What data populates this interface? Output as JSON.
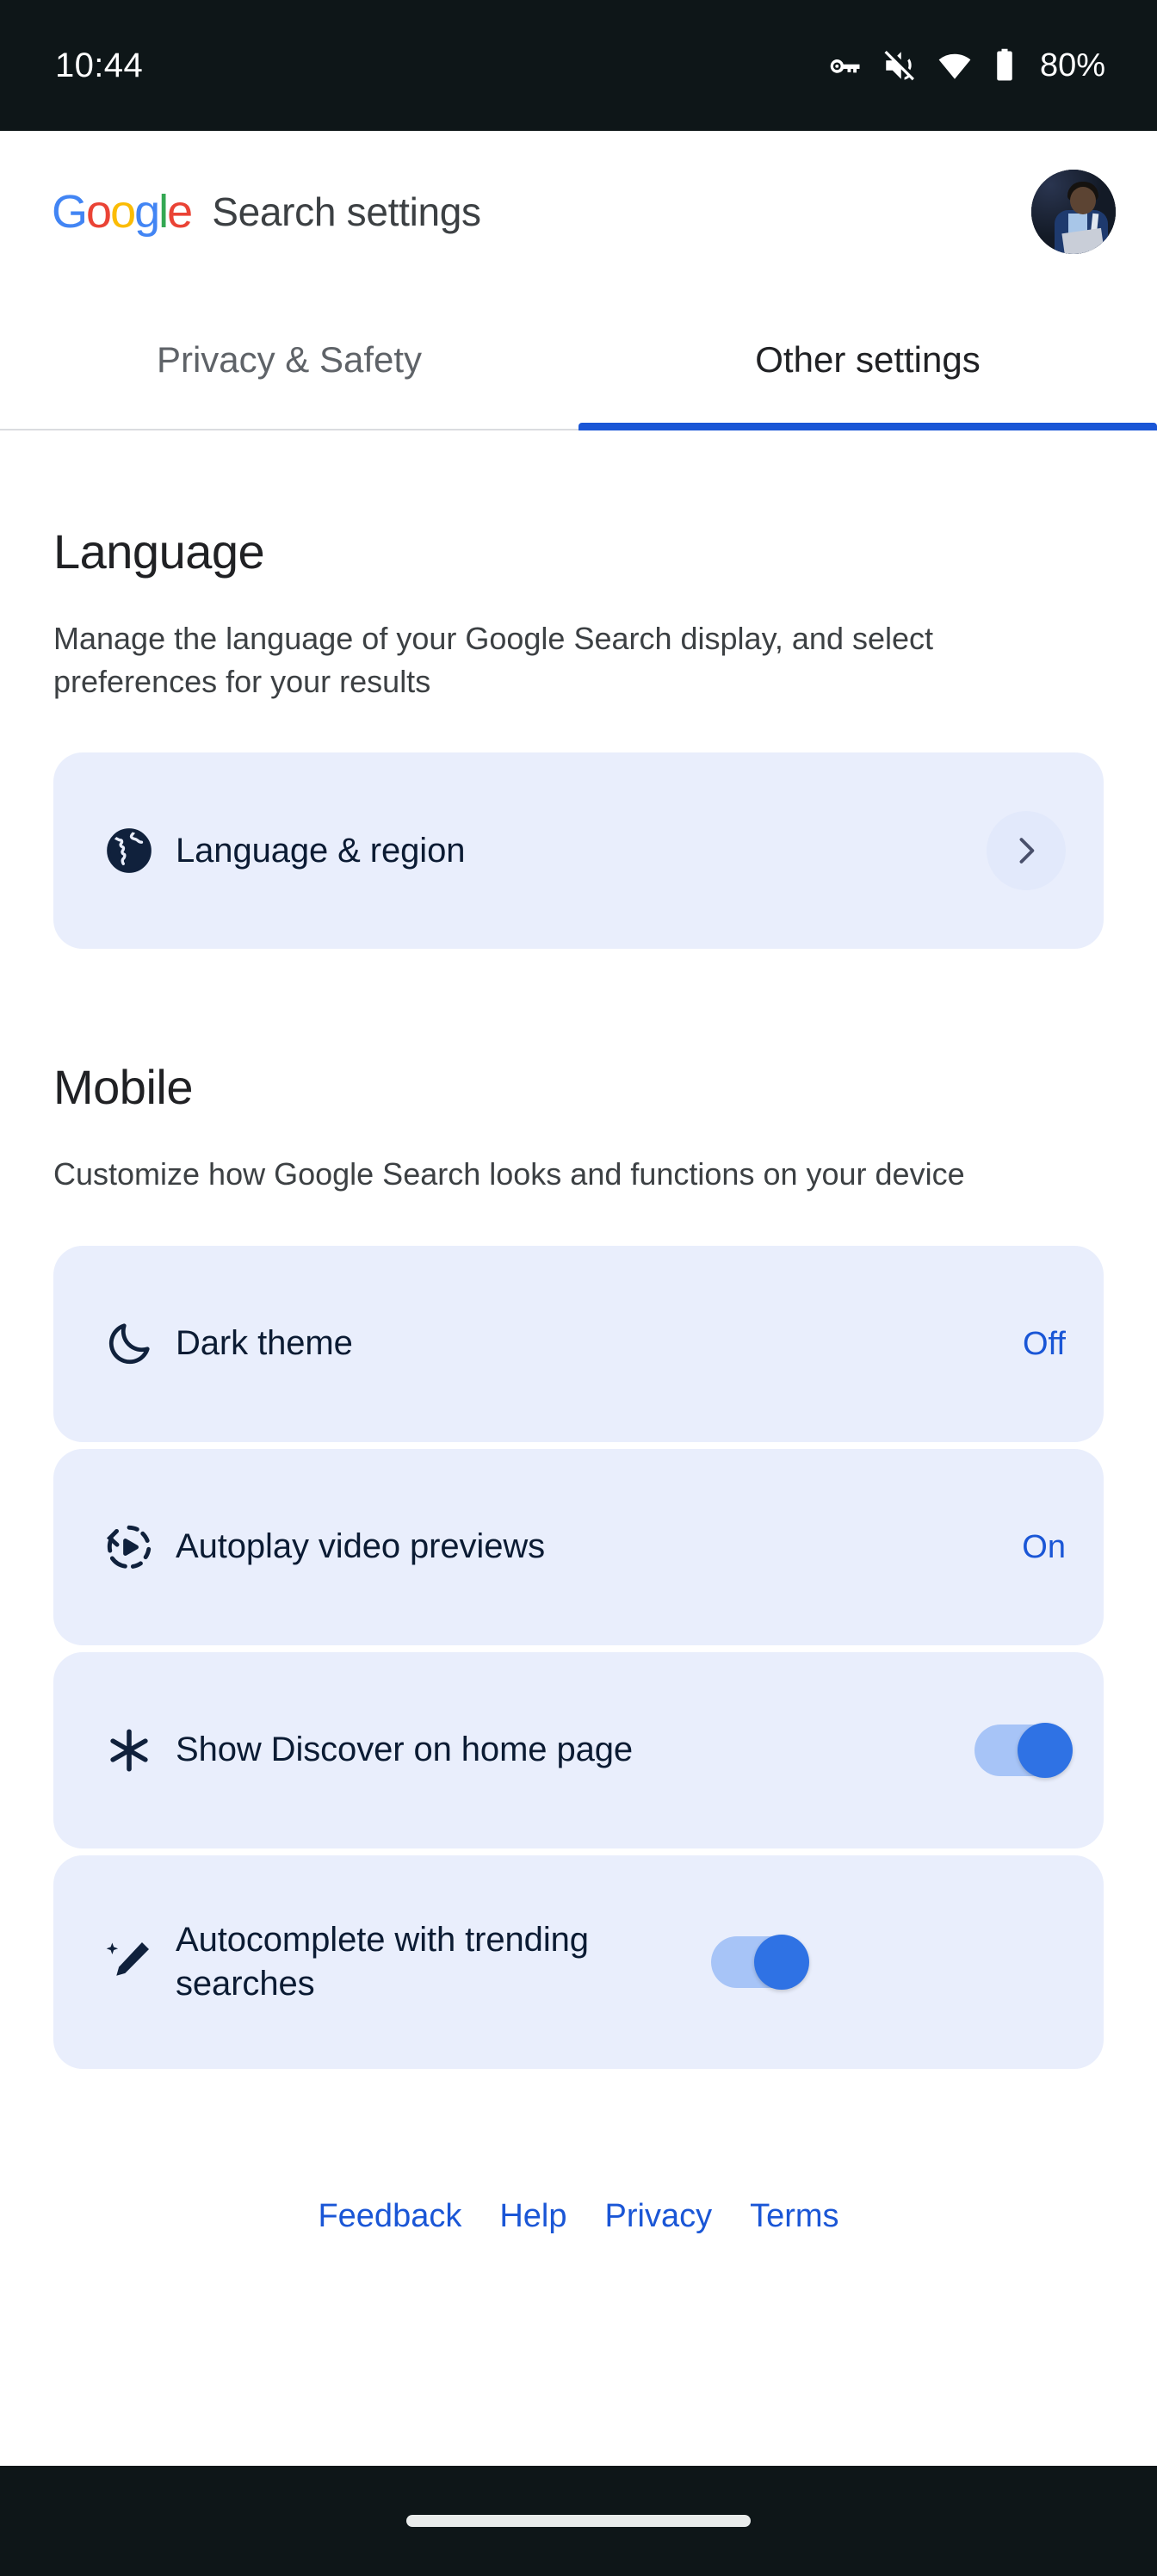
{
  "status_bar": {
    "time": "10:44",
    "battery_percent": "80%",
    "icons": [
      "key-icon",
      "volume-muted-icon",
      "wifi-icon",
      "battery-icon"
    ]
  },
  "header": {
    "logo_letters": [
      "G",
      "o",
      "o",
      "g",
      "l",
      "e"
    ],
    "title": "Search settings",
    "avatar_name": "account-avatar"
  },
  "tabs": [
    {
      "label": "Privacy & Safety",
      "active": false
    },
    {
      "label": "Other settings",
      "active": true
    }
  ],
  "sections": [
    {
      "title": "Language",
      "description": "Manage the language of your Google Search display, and select preferences for your results",
      "items": [
        {
          "label": "Language & region",
          "icon": "globe-icon",
          "control": "chevron",
          "value": ""
        }
      ]
    },
    {
      "title": "Mobile",
      "description": "Customize how Google Search looks and functions on your device",
      "items": [
        {
          "label": "Dark theme",
          "icon": "moon-icon",
          "control": "value",
          "value": "Off"
        },
        {
          "label": "Autoplay video previews",
          "icon": "autoplay-icon",
          "control": "value",
          "value": "On"
        },
        {
          "label": "Show Discover on home page",
          "icon": "asterisk-icon",
          "control": "toggle",
          "value": "On"
        },
        {
          "label": "Autocomplete with trending searches",
          "icon": "magic-pen-icon",
          "control": "toggle",
          "value": "On"
        }
      ]
    }
  ],
  "footer": {
    "links": [
      {
        "label": "Feedback"
      },
      {
        "label": "Help"
      },
      {
        "label": "Privacy"
      },
      {
        "label": "Terms"
      }
    ]
  },
  "colors": {
    "accent_blue": "#1a56d6",
    "card_background": "#e9eefc",
    "icon_navy": "#10213c",
    "toggle_track": "#a7c4f7",
    "toggle_thumb": "#2f72e4",
    "status_bar_background": "#0e1618"
  }
}
